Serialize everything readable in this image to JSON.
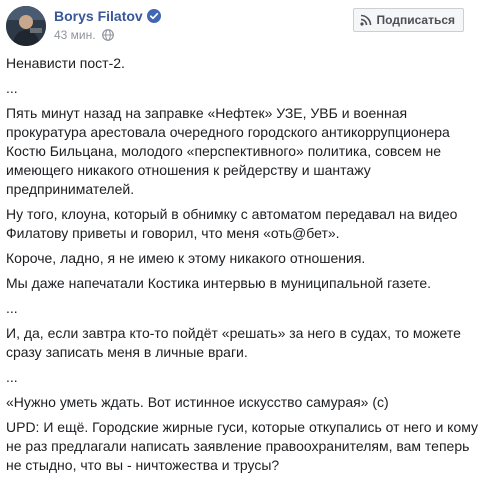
{
  "post": {
    "author": "Borys Filatov",
    "time": "43 мин.",
    "subscribe_label": "Подписаться",
    "paragraphs": [
      "Ненависти пост-2.",
      "...",
      "Пять минут назад на заправке «Нефтек» УЗЕ, УВБ и военная прокуратура арестовала очередного городского антикоррупционера Костю Бильцана, молодого «перспективного» политика, совсем не имеющего никакого отношения к рейдерству и шантажу предпринимателей.",
      "Ну того, клоуна, который в обнимку с автоматом передавал на видео Филатову приветы и говорил, что меня «оть@бет».",
      "Короче, ладно, я не имею к этому никакого отношения.",
      "Мы даже напечатали Костика интервью в муниципальной газете.",
      "...",
      "И, да, если завтра кто-то пойдёт «решать» за него в судах, то можете сразу записать меня в личные враги.",
      "...",
      "«Нужно уметь ждать. Вот истинное искусство самурая» (с)",
      "UPD: И ещё. Городские жирные гуси, которые откупались от него и кому не раз предлагали написать заявление правоохранителям, вам теперь не стыдно, что вы - ничтожества и трусы?"
    ]
  },
  "colors": {
    "author_link": "#385898",
    "verified_badge": "#4267b2",
    "meta_text": "#90949c",
    "body_text": "#1c1e21",
    "button_bg": "#f5f6f7",
    "button_border": "#ccd0d5"
  },
  "icons": {
    "verified": "verified-badge-icon",
    "privacy": "globe-icon",
    "subscribe": "rss-icon"
  }
}
